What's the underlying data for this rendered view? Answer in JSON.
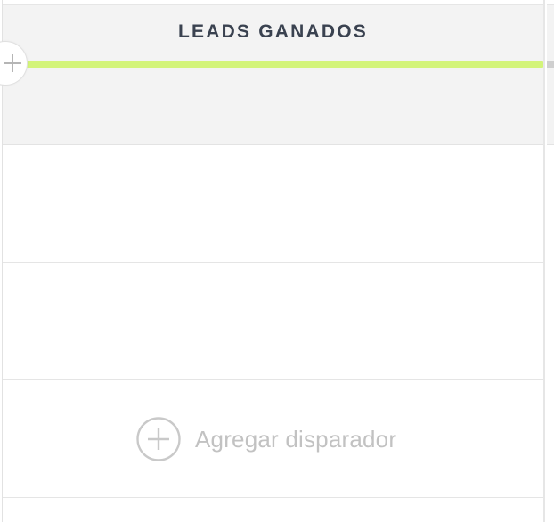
{
  "column": {
    "title": "LEADS GANADOS",
    "stage_color": "#d3f47a"
  },
  "next_column": {
    "stage_color": "#cfcfcf"
  },
  "add_stage": {
    "icon": "plus-icon"
  },
  "rows": [
    {
      "kind": "empty"
    },
    {
      "kind": "empty"
    },
    {
      "kind": "add-trigger",
      "label": "Agregar disparador",
      "icon": "plus-circle-icon"
    },
    {
      "kind": "empty"
    }
  ],
  "colors": {
    "header_bg": "#f3f3f3",
    "title_text": "#3a4250",
    "muted_text": "#c2c2c2",
    "divider": "#e5e5e5"
  }
}
